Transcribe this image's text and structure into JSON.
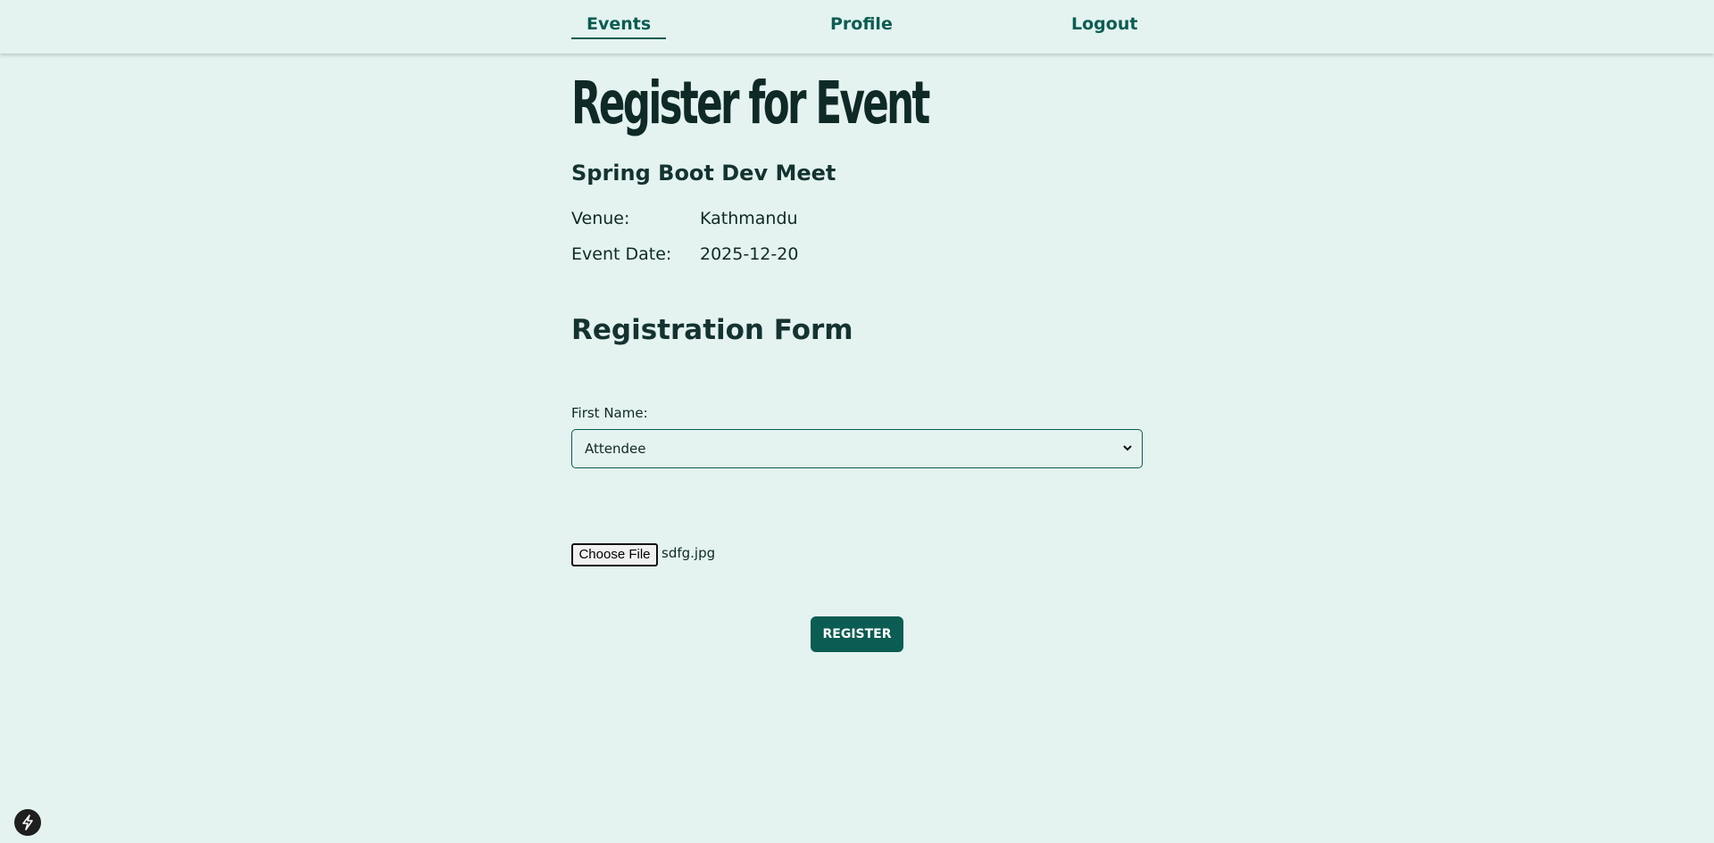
{
  "nav": {
    "events_label": "Events",
    "profile_label": "Profile",
    "logout_label": "Logout",
    "active": "Events"
  },
  "page": {
    "title": "Register for Event"
  },
  "event": {
    "name": "Spring Boot Dev Meet",
    "venue_label": "Venue:",
    "venue": "Kathmandu",
    "date_label": "Event Date:",
    "date": "2025-12-20"
  },
  "form": {
    "title": "Registration Form",
    "first_name_label": "First Name:",
    "role_selected": "Attendee",
    "choose_file_label": "Choose File",
    "file_name": "sdfg.jpg",
    "register_label": "REGISTER"
  },
  "icons": {
    "select": "chevron-down-icon",
    "badge": "lightning-icon"
  },
  "colors": {
    "background": "#e4f3f0",
    "accent": "#0b5c52",
    "text": "#0f2a26"
  }
}
